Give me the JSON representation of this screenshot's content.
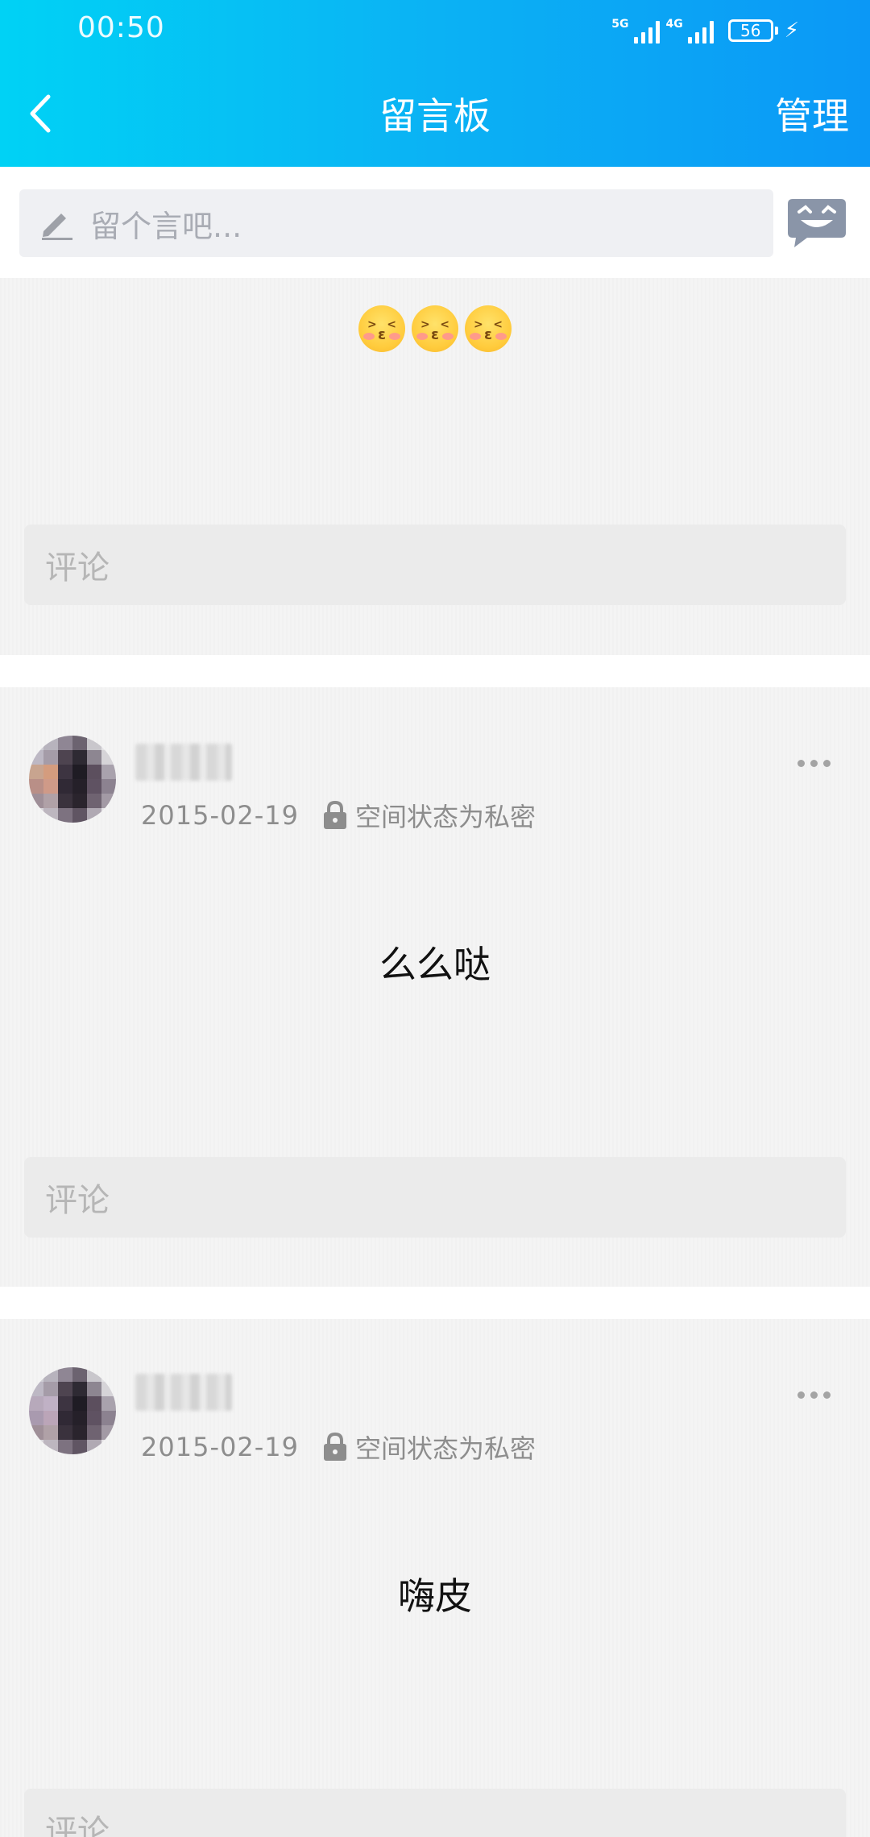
{
  "status_bar": {
    "time": "00:50",
    "signal1": "5G",
    "signal2": "4G",
    "battery": "56"
  },
  "header": {
    "title": "留言板",
    "manage_label": "管理"
  },
  "composer": {
    "placeholder": "留个言吧..."
  },
  "posts": [
    {
      "text": "",
      "emoji_count": 3,
      "emoji_name": "kiss-emoji",
      "comment_placeholder": "评论"
    },
    {
      "date": "2015-02-19",
      "privacy": "空间状态为私密",
      "text": "么么哒",
      "comment_placeholder": "评论"
    },
    {
      "date": "2015-02-19",
      "privacy": "空间状态为私密",
      "text": "嗨皮",
      "comment_placeholder": "评论"
    }
  ],
  "colors": {
    "header_start": "#00d2f5",
    "header_end": "#0b98f6",
    "background": "#f4f4f4",
    "comment_box": "#ebebeb"
  }
}
